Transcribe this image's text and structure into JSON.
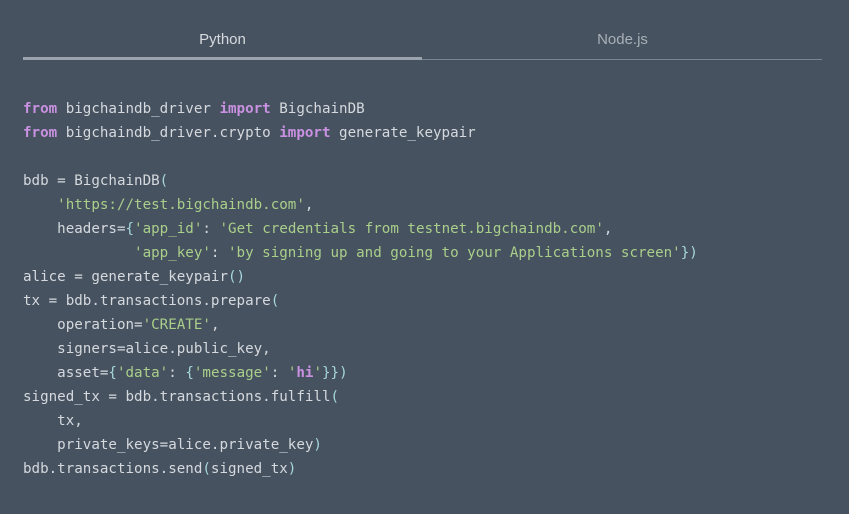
{
  "tabs": [
    {
      "label": "Python",
      "active": true
    },
    {
      "label": "Node.js",
      "active": false
    }
  ],
  "colors": {
    "background": "#475260",
    "text": "#d5d9de",
    "keyword": "#c991e1",
    "string": "#a9cf8a",
    "bracket": "#a6d7dc"
  },
  "code": {
    "language": "python",
    "lines": [
      [
        {
          "t": "kw",
          "v": "from"
        },
        {
          "t": "pl",
          "v": " bigchaindb_driver "
        },
        {
          "t": "kw",
          "v": "import"
        },
        {
          "t": "pl",
          "v": " BigchainDB"
        }
      ],
      [
        {
          "t": "kw",
          "v": "from"
        },
        {
          "t": "pl",
          "v": " bigchaindb_driver.crypto "
        },
        {
          "t": "kw",
          "v": "import"
        },
        {
          "t": "pl",
          "v": " generate_keypair"
        }
      ],
      [],
      [
        {
          "t": "pl",
          "v": "bdb = BigchainDB"
        },
        {
          "t": "br",
          "v": "("
        }
      ],
      [
        {
          "t": "pl",
          "v": "    "
        },
        {
          "t": "str",
          "v": "'https://test.bigchaindb.com'"
        },
        {
          "t": "pl",
          "v": ","
        }
      ],
      [
        {
          "t": "pl",
          "v": "    headers="
        },
        {
          "t": "br",
          "v": "{"
        },
        {
          "t": "str",
          "v": "'app_id'"
        },
        {
          "t": "pl",
          "v": ": "
        },
        {
          "t": "str",
          "v": "'Get credentials from testnet.bigchaindb.com'"
        },
        {
          "t": "pl",
          "v": ","
        }
      ],
      [
        {
          "t": "pl",
          "v": "             "
        },
        {
          "t": "str",
          "v": "'app_key'"
        },
        {
          "t": "pl",
          "v": ": "
        },
        {
          "t": "str",
          "v": "'by signing up and going to your Applications screen'"
        },
        {
          "t": "br",
          "v": "})"
        }
      ],
      [
        {
          "t": "pl",
          "v": "alice = generate_keypair"
        },
        {
          "t": "br",
          "v": "()"
        }
      ],
      [
        {
          "t": "pl",
          "v": "tx = bdb.transactions.prepare"
        },
        {
          "t": "br",
          "v": "("
        }
      ],
      [
        {
          "t": "pl",
          "v": "    operation="
        },
        {
          "t": "str",
          "v": "'CREATE'"
        },
        {
          "t": "pl",
          "v": ","
        }
      ],
      [
        {
          "t": "pl",
          "v": "    signers=alice.public_key,"
        }
      ],
      [
        {
          "t": "pl",
          "v": "    asset="
        },
        {
          "t": "br",
          "v": "{"
        },
        {
          "t": "str",
          "v": "'data'"
        },
        {
          "t": "pl",
          "v": ": "
        },
        {
          "t": "br",
          "v": "{"
        },
        {
          "t": "str",
          "v": "'message'"
        },
        {
          "t": "pl",
          "v": ": "
        },
        {
          "t": "str",
          "v": "'"
        },
        {
          "t": "kw",
          "v": "hi"
        },
        {
          "t": "str",
          "v": "'"
        },
        {
          "t": "br",
          "v": "}})"
        }
      ],
      [
        {
          "t": "pl",
          "v": "signed_tx = bdb.transactions.fulfill"
        },
        {
          "t": "br",
          "v": "("
        }
      ],
      [
        {
          "t": "pl",
          "v": "    tx,"
        }
      ],
      [
        {
          "t": "pl",
          "v": "    private_keys=alice.private_key"
        },
        {
          "t": "br",
          "v": ")"
        }
      ],
      [
        {
          "t": "pl",
          "v": "bdb.transactions.send"
        },
        {
          "t": "br",
          "v": "("
        },
        {
          "t": "pl",
          "v": "signed_tx"
        },
        {
          "t": "br",
          "v": ")"
        }
      ]
    ]
  }
}
